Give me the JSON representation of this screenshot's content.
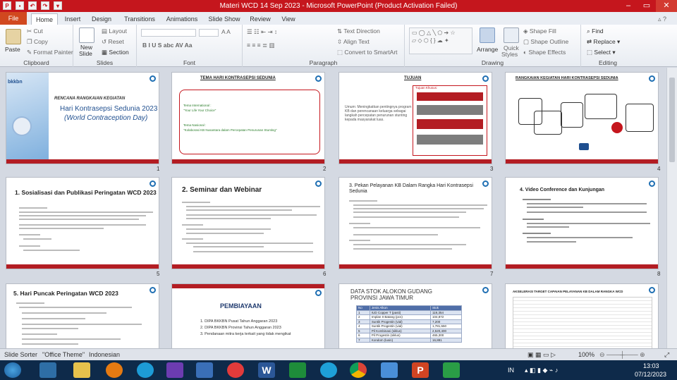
{
  "window": {
    "title": "Materi WCD 14 Sep 2023  -  Microsoft PowerPoint (Product Activation Failed)"
  },
  "tabs": [
    {
      "label": "File"
    },
    {
      "label": "Home"
    },
    {
      "label": "Insert"
    },
    {
      "label": "Design"
    },
    {
      "label": "Transitions"
    },
    {
      "label": "Animations"
    },
    {
      "label": "Slide Show"
    },
    {
      "label": "Review"
    },
    {
      "label": "View"
    }
  ],
  "ribbon": {
    "clipboard": {
      "label": "Clipboard",
      "paste": "Paste",
      "cut": "Cut",
      "copy": "Copy",
      "format_painter": "Format Painter"
    },
    "slides": {
      "label": "Slides",
      "new_slide": "New",
      "new_slide2": "Slide",
      "layout": "Layout",
      "reset": "Reset",
      "section": "Section"
    },
    "font": {
      "label": "Font"
    },
    "paragraph": {
      "label": "Paragraph",
      "text_direction": "Text Direction",
      "align_text": "Align Text",
      "convert": "Convert to SmartArt"
    },
    "drawing": {
      "label": "Drawing",
      "arrange": "Arrange",
      "quick": "Quick",
      "styles": "Styles",
      "shape_fill": "Shape Fill",
      "shape_outline": "Shape Outline",
      "shape_effects": "Shape Effects"
    },
    "editing": {
      "label": "Editing",
      "find": "Find",
      "replace": "Replace",
      "select": "Select"
    }
  },
  "slides": [
    {
      "num": "1",
      "subtitle": "RENCANA RANGKAIAN KEGIATAN",
      "title1": "Hari Kontrasepsi Sedunia 2023",
      "title2": "(World Contraception Day)"
    },
    {
      "num": "2",
      "title": "TEMA HARI KONTRASEPSI SEDUNIA",
      "t1": "Tema International :",
      "t2": "\"Your Life Your Choice\"",
      "t3": "Tema Nasional :",
      "t4": "\"Kolaborasi KB Nusantara dalam Percepatan Penurunan Stunting\""
    },
    {
      "num": "3",
      "title": "TUJUAN",
      "left": "Umum: Meningkatkan pentingnya program KB dan perencanaan keluarga sebagai langkah percepatan penurunan stunting kepada masyarakat luas.",
      "box_title": "Tujuan Khusus:"
    },
    {
      "num": "4",
      "title": "RANGKAIAN KEGIATAN HARI KONTRASEPSI SEDUNIA"
    },
    {
      "num": "5",
      "title": "1. Sosialisasi dan Publikasi Peringatan WCD 2023"
    },
    {
      "num": "6",
      "title": "2. Seminar dan Webinar"
    },
    {
      "num": "7",
      "title": "3. Pekan Pelayanan KB Dalam Rangka Hari Kontrasepsi Sedunia"
    },
    {
      "num": "8",
      "title": "4. Video Conference dan Kunjungan"
    },
    {
      "num": "",
      "title": "5. Hari Puncak Peringatan WCD 2023"
    },
    {
      "num": "",
      "title": "PEMBIAYAAN",
      "items": [
        "DIPA BKKBN Pusat Tahun Anggaran 2023",
        "DIPA BKKBN Provinsi Tahun Anggaran 2023",
        "Pendanaan mitra kerja terkait yang tidak mengikat"
      ]
    },
    {
      "num": "",
      "title": "DATA STOK ALOKON GUDANG PROVINSI JAWA TIMUR",
      "rows": [
        [
          "No",
          "Jenis Alkon",
          "Stok"
        ],
        [
          "1",
          "IUD Copper T (pasti)",
          "119,354"
        ],
        [
          "2",
          "Implan II Batang (pcs)",
          "104,872"
        ],
        [
          "3",
          "Suntik Progestin (vial)",
          "7,200"
        ],
        [
          "4",
          "Suntik Progestin (vial)",
          "1,781,550"
        ],
        [
          "5",
          "Pil Kombinasi (siklus)",
          "2,520,400"
        ],
        [
          "6",
          "Pil Progestin (siklus)",
          "465,300"
        ],
        [
          "7",
          "Kondom (lusin)",
          "16,881"
        ]
      ]
    },
    {
      "num": "",
      "title": "AKSELERASI TARGET CAPAIAN PELAYANAN KB DALAM RANGKA WCD"
    }
  ],
  "status": {
    "view": "Slide Sorter",
    "theme": "\"Office Theme\"",
    "lang": "Indonesian",
    "zoom": "100%"
  },
  "tray": {
    "lang": "IN",
    "time": "13:03",
    "date": "07/12/2023"
  }
}
